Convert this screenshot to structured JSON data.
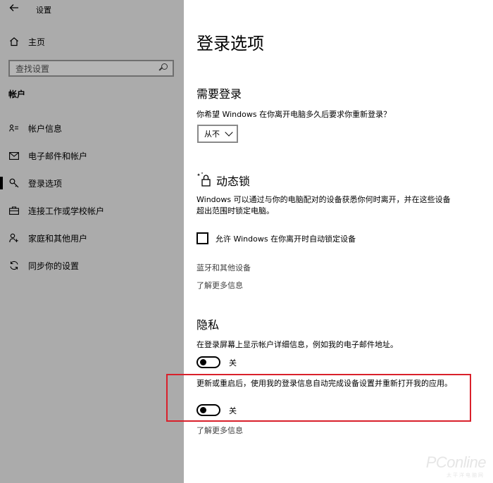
{
  "window": {
    "title": "设置"
  },
  "sidebar": {
    "home_label": "主页",
    "search_placeholder": "查找设置",
    "section_title": "帐户",
    "items": [
      {
        "label": "帐户信息",
        "icon": "person-card-icon"
      },
      {
        "label": "电子邮件和帐户",
        "icon": "mail-icon"
      },
      {
        "label": "登录选项",
        "icon": "key-icon",
        "active": true
      },
      {
        "label": "连接工作或学校帐户",
        "icon": "briefcase-icon"
      },
      {
        "label": "家庭和其他用户",
        "icon": "person-add-icon"
      },
      {
        "label": "同步你的设置",
        "icon": "sync-icon"
      }
    ]
  },
  "main": {
    "title": "登录选项",
    "require_signin": {
      "heading": "需要登录",
      "question": "你希望 Windows 在你离开电脑多久后要求你重新登录？",
      "dropdown_value": "从不"
    },
    "dynamic_lock": {
      "heading": "动态锁",
      "description": "Windows 可以通过与你的电脑配对的设备获悉你何时离开，并在这些设备超出范围时锁定电脑。",
      "checkbox_label": "允许 Windows 在你离开时自动锁定设备",
      "link_bluetooth": "蓝牙和其他设备",
      "link_learn_more": "了解更多信息"
    },
    "privacy": {
      "heading": "隐私",
      "setting1_text": "在登录屏幕上显示帐户详细信息，例如我的电子邮件地址。",
      "setting1_state": "关",
      "setting2_text": "更新或重启后，使用我的登录信息自动完成设备设置并重新打开我的应用。",
      "setting2_state": "关",
      "link_learn_more": "了解更多信息"
    }
  },
  "watermark": {
    "brand": "PConline",
    "sub": "太平洋电脑网"
  },
  "colors": {
    "sidebar_bg": "#ababab",
    "highlight_box": "#d9202b"
  }
}
